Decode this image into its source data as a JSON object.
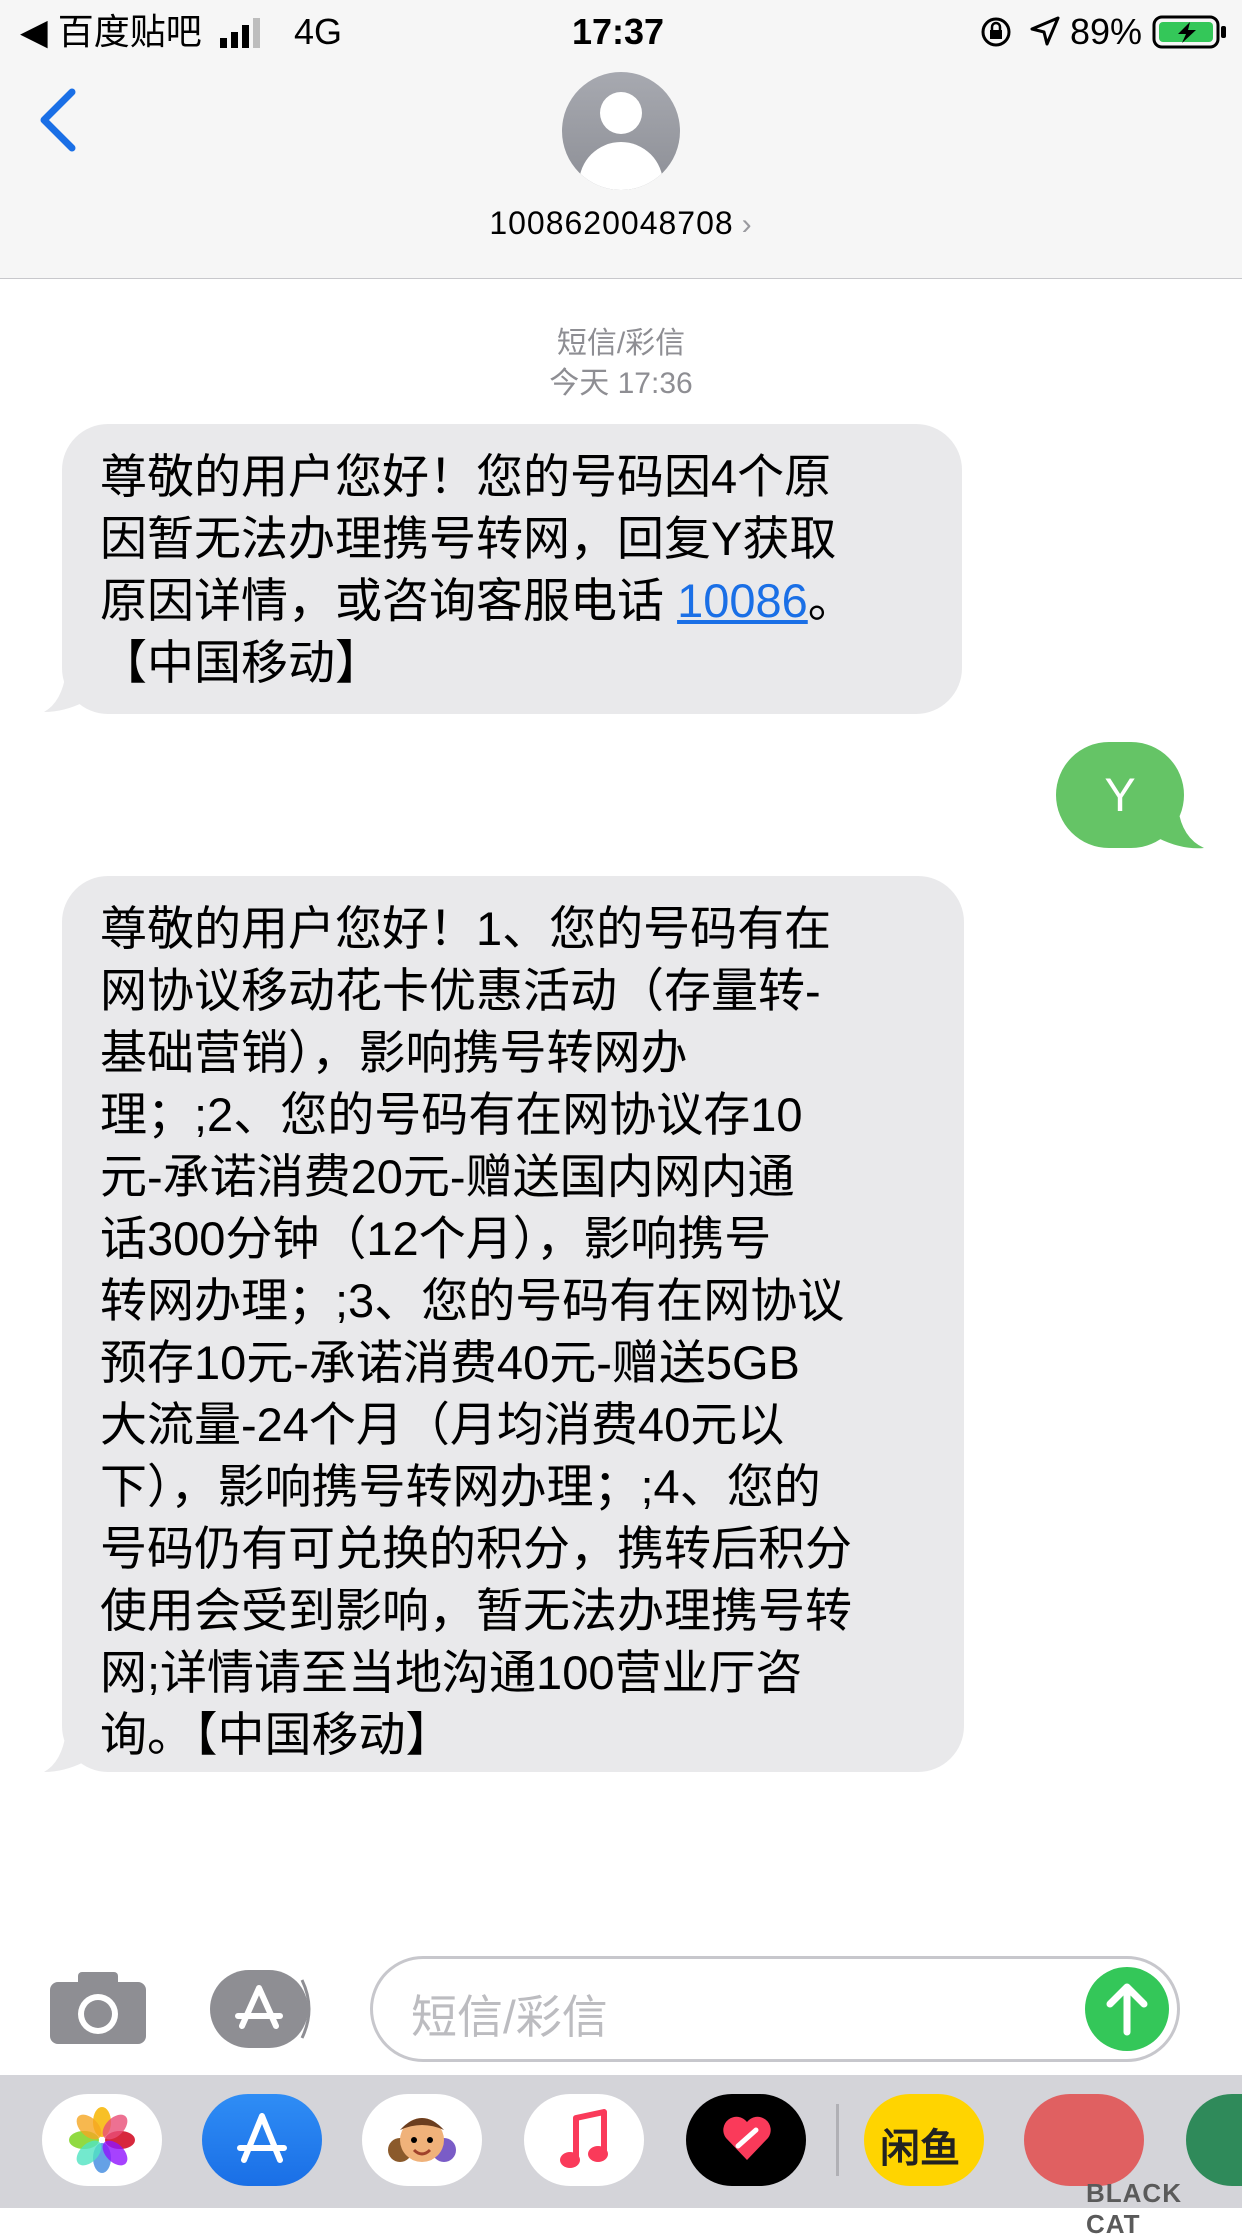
{
  "status_bar": {
    "back_app": "◀ 百度贴吧",
    "network": "4G",
    "time": "17:37",
    "battery_percent": "89%",
    "signal_bars": 3
  },
  "header": {
    "contact_number": "1008620048708",
    "contact_chevron": "›"
  },
  "thread": {
    "service_label": "短信/彩信",
    "timestamp": "今天 17:36",
    "messages": [
      {
        "direction": "incoming",
        "lines": [
          "尊敬的用户您好！您的号码因4个原",
          "因暂无法办理携号转网，回复Y获取"
        ],
        "line3_pre": "原因详情，或咨询客服电话 ",
        "link": "10086",
        "line3_post": "。",
        "line4": "【中国移动】"
      },
      {
        "direction": "outgoing",
        "text": "Y"
      },
      {
        "direction": "incoming",
        "lines": [
          "尊敬的用户您好！1、您的号码有在",
          "网协议移动花卡优惠活动（存量转-",
          "基础营销），影响携号转网办",
          "理；;2、您的号码有在网协议存10",
          "元-承诺消费20元-赠送国内网内通",
          "话300分钟（12个月），影响携号",
          "转网办理；;3、您的号码有在网协议",
          "预存10元-承诺消费40元-赠送5GB",
          "大流量-24个月（月均消费40元以",
          "下），影响携号转网办理；;4、您的",
          "号码仍有可兑换的积分，携转后积分",
          "使用会受到影响，暂无法办理携号转",
          "网;详情请至当地沟通100营业厅咨",
          "询。【中国移动】"
        ]
      }
    ]
  },
  "composer": {
    "placeholder": "短信/彩信",
    "camera_icon": "camera-icon",
    "appstore_icon": "appstore-icon",
    "send_icon": "arrow-up-icon"
  },
  "dock": {
    "apps": [
      "photos",
      "app-store",
      "memoji",
      "music",
      "digital-touch",
      "xianyu",
      "unknown"
    ],
    "xianyu_label": "闲鱼"
  },
  "watermark": {
    "text": "BLACK CAT"
  },
  "colors": {
    "ios_blue": "#1a6fe6",
    "incoming_bubble": "#e9e9eb",
    "outgoing_bubble": "#65c466",
    "send_green": "#34c759"
  }
}
